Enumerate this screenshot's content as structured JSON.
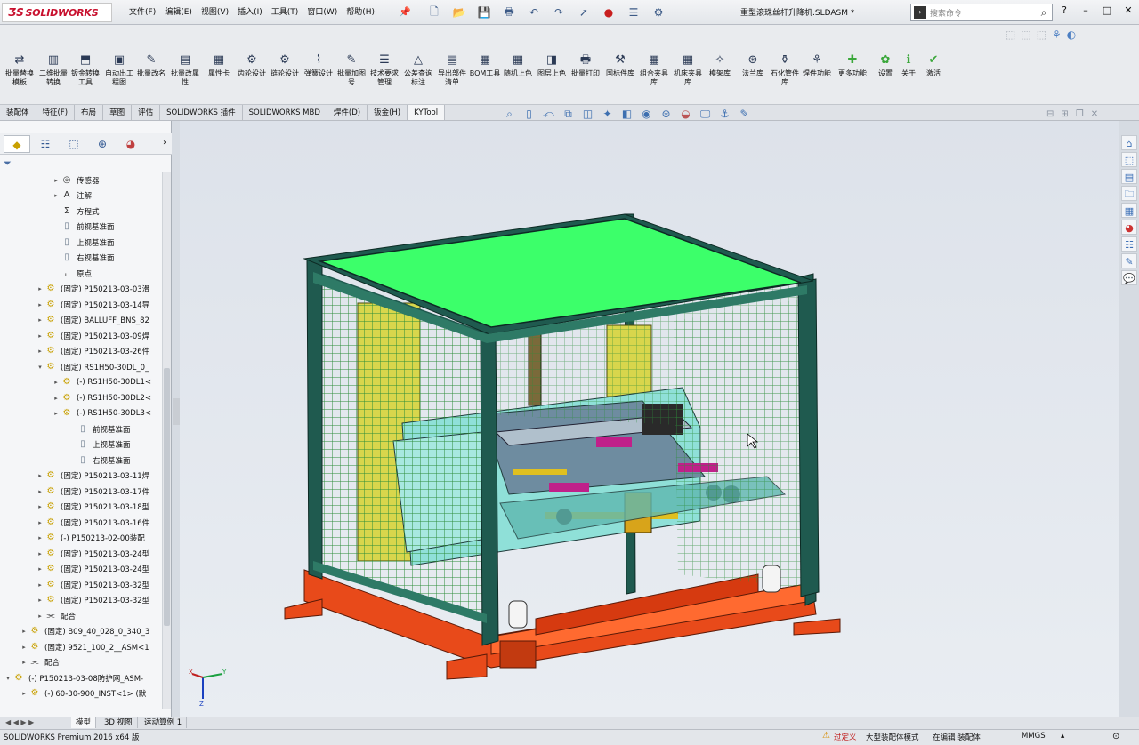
{
  "app": {
    "logo_text": "SOLIDWORKS",
    "document_title": "重型滚珠丝杆升降机.SLDASM *"
  },
  "menu": [
    "文件(F)",
    "编辑(E)",
    "视图(V)",
    "插入(I)",
    "工具(T)",
    "窗口(W)",
    "帮助(H)"
  ],
  "quick_access": [
    "new-icon",
    "open-icon",
    "save-icon",
    "print-icon",
    "undo-icon",
    "redo-icon",
    "select-icon",
    "rebuild-icon",
    "file-properties-icon",
    "options-icon"
  ],
  "search": {
    "placeholder": "搜索命令"
  },
  "window_controls": [
    "?",
    "–",
    "□",
    "✕"
  ],
  "ribbon_buttons": [
    {
      "label": "批量替换模板",
      "icon": "batch-replace-icon"
    },
    {
      "label": "二维批量转换",
      "icon": "batch-convert-icon"
    },
    {
      "label": "钣金转换工具",
      "icon": "sheetmetal-convert-icon"
    },
    {
      "label": "自动出工程图",
      "icon": "auto-drawing-icon"
    },
    {
      "label": "批量改名",
      "icon": "batch-rename-icon"
    },
    {
      "label": "批量改属性",
      "icon": "batch-property-icon"
    },
    {
      "label": "属性卡",
      "icon": "property-card-icon"
    },
    {
      "label": "齿轮设计",
      "icon": "gear-design-icon"
    },
    {
      "label": "链轮设计",
      "icon": "sprocket-design-icon"
    },
    {
      "label": "弹簧设计",
      "icon": "spring-design-icon"
    },
    {
      "label": "批量加图号",
      "icon": "add-drawing-number-icon"
    },
    {
      "label": "技术要求管理",
      "icon": "tech-requirements-icon"
    },
    {
      "label": "公差查询标注",
      "icon": "tolerance-icon"
    },
    {
      "label": "导出部件清单",
      "icon": "export-bom-icon"
    },
    {
      "label": "BOM工具",
      "icon": "bom-tool-icon"
    },
    {
      "label": "随机上色",
      "icon": "random-color-icon"
    },
    {
      "label": "图层上色",
      "icon": "layer-color-icon"
    },
    {
      "label": "批量打印",
      "icon": "batch-print-icon"
    },
    {
      "label": "国标件库",
      "icon": "standard-parts-icon"
    },
    {
      "label": "组合夹具库",
      "icon": "fixture-library-icon"
    },
    {
      "label": "机床夹具库",
      "icon": "machine-fixture-icon"
    },
    {
      "label": "模架库",
      "icon": "mold-base-icon"
    },
    {
      "label": "法兰库",
      "icon": "flange-library-icon"
    },
    {
      "label": "石化管件库",
      "icon": "pipe-fittings-icon"
    },
    {
      "label": "焊件功能",
      "icon": "weldment-icon"
    },
    {
      "label": "更多功能",
      "icon": "more-functions-icon"
    },
    {
      "label": "设置",
      "icon": "settings-icon"
    },
    {
      "label": "关于",
      "icon": "about-icon"
    },
    {
      "label": "激活",
      "icon": "activate-icon"
    }
  ],
  "command_tabs": [
    "装配体",
    "特征(F)",
    "布局",
    "草图",
    "评估",
    "SOLIDWORKS 插件",
    "SOLIDWORKS MBD",
    "焊件(D)",
    "钣金(H)",
    "KYTool"
  ],
  "active_command_tab": "KYTool",
  "panel_tabs": [
    "feature-manager-icon",
    "property-manager-icon",
    "configuration-manager-icon",
    "display-manager-icon"
  ],
  "tree": [
    {
      "indent": 3,
      "toggle": "▸",
      "icon": "sensor-icon",
      "label": "传感器"
    },
    {
      "indent": 3,
      "toggle": "▸",
      "icon": "annotation-icon",
      "label": "注解"
    },
    {
      "indent": 3,
      "toggle": "",
      "icon": "equation-icon",
      "label": "方程式"
    },
    {
      "indent": 3,
      "toggle": "",
      "icon": "plane-icon",
      "label": "前视基准面"
    },
    {
      "indent": 3,
      "toggle": "",
      "icon": "plane-icon",
      "label": "上视基准面"
    },
    {
      "indent": 3,
      "toggle": "",
      "icon": "plane-icon",
      "label": "右视基准面"
    },
    {
      "indent": 3,
      "toggle": "",
      "icon": "origin-icon",
      "label": "原点"
    },
    {
      "indent": 2,
      "toggle": "▸",
      "icon": "part-icon",
      "label": "(固定) P150213-03-03滑"
    },
    {
      "indent": 2,
      "toggle": "▸",
      "icon": "part-icon",
      "label": "(固定) P150213-03-14导"
    },
    {
      "indent": 2,
      "toggle": "▸",
      "icon": "part-icon",
      "label": "(固定) BALLUFF_BNS_82"
    },
    {
      "indent": 2,
      "toggle": "▸",
      "icon": "part-icon",
      "label": "(固定) P150213-03-09焊"
    },
    {
      "indent": 2,
      "toggle": "▸",
      "icon": "part-icon",
      "label": "(固定) P150213-03-26件"
    },
    {
      "indent": 2,
      "toggle": "▾",
      "icon": "part-icon",
      "label": "(固定) RS1H50-30DL_0_"
    },
    {
      "indent": 3,
      "toggle": "▸",
      "icon": "part-icon",
      "label": "(-) RS1H50-30DL1<"
    },
    {
      "indent": 3,
      "toggle": "▸",
      "icon": "part-icon",
      "label": "(-) RS1H50-30DL2<"
    },
    {
      "indent": 3,
      "toggle": "▸",
      "icon": "part-icon",
      "label": "(-) RS1H50-30DL3<"
    },
    {
      "indent": 4,
      "toggle": "",
      "icon": "plane-icon",
      "label": "前视基准面"
    },
    {
      "indent": 4,
      "toggle": "",
      "icon": "plane-icon",
      "label": "上视基准面"
    },
    {
      "indent": 4,
      "toggle": "",
      "icon": "plane-icon",
      "label": "右视基准面"
    },
    {
      "indent": 2,
      "toggle": "▸",
      "icon": "part-icon",
      "label": "(固定) P150213-03-11焊"
    },
    {
      "indent": 2,
      "toggle": "▸",
      "icon": "part-icon",
      "label": "(固定) P150213-03-17件"
    },
    {
      "indent": 2,
      "toggle": "▸",
      "icon": "part-icon",
      "label": "(固定) P150213-03-18型"
    },
    {
      "indent": 2,
      "toggle": "▸",
      "icon": "part-icon",
      "label": "(固定) P150213-03-16件"
    },
    {
      "indent": 2,
      "toggle": "▸",
      "icon": "part-icon",
      "label": "(-) P150213-02-00装配"
    },
    {
      "indent": 2,
      "toggle": "▸",
      "icon": "part-icon",
      "label": "(固定) P150213-03-24型"
    },
    {
      "indent": 2,
      "toggle": "▸",
      "icon": "part-icon",
      "label": "(固定) P150213-03-24型"
    },
    {
      "indent": 2,
      "toggle": "▸",
      "icon": "part-icon",
      "label": "(固定) P150213-03-32型"
    },
    {
      "indent": 2,
      "toggle": "▸",
      "icon": "part-icon",
      "label": "(固定) P150213-03-32型"
    },
    {
      "indent": 2,
      "toggle": "▸",
      "icon": "mate-icon",
      "label": "配合"
    },
    {
      "indent": 1,
      "toggle": "▸",
      "icon": "part-icon",
      "label": "(固定) B09_40_028_0_340_3"
    },
    {
      "indent": 1,
      "toggle": "▸",
      "icon": "part-icon",
      "label": "(固定) 9521_100_2__ASM<1"
    },
    {
      "indent": 1,
      "toggle": "▸",
      "icon": "mate-icon",
      "label": "配合"
    },
    {
      "indent": 0,
      "toggle": "▾",
      "icon": "part-icon",
      "label": "(-) P150213-03-08防护网_ASM-"
    },
    {
      "indent": 1,
      "toggle": "▸",
      "icon": "part-icon",
      "label": "(-) 60-30-900_INST<1> (默"
    }
  ],
  "view_toolbar_icons": [
    "zoom-fit-icon",
    "zoom-area-icon",
    "previous-view-icon",
    "section-view-icon",
    "dynamic-annotation-icon",
    "view-orientation-icon",
    "display-style-icon",
    "hide-show-icon",
    "edit-appearance-icon",
    "apply-scene-icon",
    "view-settings-icon",
    "render-tools-icon"
  ],
  "task_pane_icons": [
    "home-icon",
    "3d-content-icon",
    "design-library-icon",
    "file-explorer-icon",
    "view-palette-icon",
    "appearances-icon",
    "custom-properties-icon",
    "forum-icon"
  ],
  "model_tabs": [
    "模型",
    "3D 视图",
    "运动算例 1"
  ],
  "status": {
    "app_version": "SOLIDWORKS Premium 2016 x64 版",
    "over_defined": "过定义",
    "large_assembly": "大型装配体模式",
    "editing": "在编辑 装配体",
    "units": "MMGS",
    "units_arrow": "▴"
  },
  "colors": {
    "cover_green": "#3cff6a",
    "frame_dark": "#1f5a4f",
    "base_red": "#e84a1a",
    "plate_cyan": "#8fe0d8",
    "tool_yellow": "#d8d64c",
    "magenta": "#c0208a"
  }
}
